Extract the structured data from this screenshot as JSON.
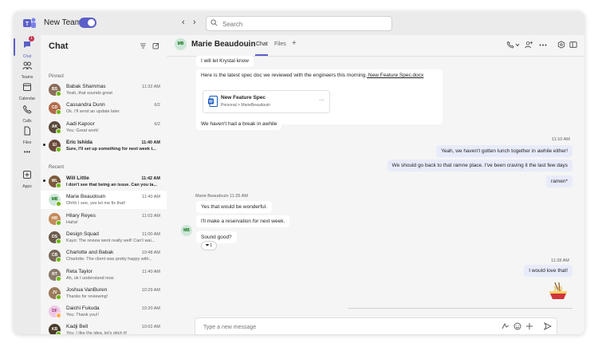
{
  "app": {
    "title": "New Teams",
    "toggle_on": true,
    "back_label": "‹",
    "forward_label": "›",
    "search_placeholder": "Search"
  },
  "rail": {
    "items": [
      {
        "label": "Chat",
        "icon": "chat-icon",
        "badge": "1",
        "active": true
      },
      {
        "label": "Teams",
        "icon": "teams-icon"
      },
      {
        "label": "Calendar",
        "icon": "calendar-icon"
      },
      {
        "label": "Calls",
        "icon": "calls-icon"
      },
      {
        "label": "Files",
        "icon": "files-icon"
      },
      {
        "label": "Apps",
        "icon": "apps-icon"
      }
    ],
    "more_label": "•••"
  },
  "chatlist": {
    "title": "Chat",
    "pinned_label": "Pinned",
    "recent_label": "Recent",
    "pinned": [
      {
        "name": "Babak Shammas",
        "time": "11:32 AM",
        "preview": "Yeah, that sounds great",
        "initials": "BS",
        "color": "#8a6d5a"
      },
      {
        "name": "Cassandra Dunn",
        "time": "6/2",
        "preview": "Ok. I'll send an update later.",
        "initials": "CD",
        "color": "#b36b4a"
      },
      {
        "name": "Aadi Kapoor",
        "time": "6/2",
        "preview": "You: Great work!",
        "initials": "AK",
        "color": "#5a4a3a"
      },
      {
        "name": "Eric Ishida",
        "time": "11:40 AM",
        "preview": "Sure, I'll set up something for next week t...",
        "initials": "EI",
        "color": "#6b4a3a",
        "unread": true
      }
    ],
    "recent": [
      {
        "name": "Will Little",
        "time": "11:42 AM",
        "preview": "I don't see that being an issue. Can you ta...",
        "initials": "WL",
        "color": "#7a5a3a",
        "unread": true
      },
      {
        "name": "Marie Beaudouin",
        "time": "11:40 AM",
        "preview": "Ohhh I see, yes let me fix that!",
        "initials": "MB",
        "color": "#cde6d8",
        "text": "#0e700e",
        "selected": true
      },
      {
        "name": "Hilary Reyes",
        "time": "11:02 AM",
        "preview": "Haha!",
        "initials": "HR",
        "color": "#c48a5a"
      },
      {
        "name": "Design Squad",
        "time": "11:00 AM",
        "preview": "Kayo: The review went really well! Can't wai...",
        "initials": "DS",
        "color": "#6a5a4a"
      },
      {
        "name": "Charlotte and Babak",
        "time": "10:48 AM",
        "preview": "Charlotte: The client was pretty happy with...",
        "initials": "CB",
        "color": "#7a6a5a"
      },
      {
        "name": "Reta Taylor",
        "time": "11:40 AM",
        "preview": "Ah, ok I understand now.",
        "initials": "RT",
        "color": "#8a7a6a"
      },
      {
        "name": "Joshua VanBuren",
        "time": "10:29 AM",
        "preview": "Thanks for reviewing!",
        "initials": "JV",
        "color": "#9a7a5a"
      },
      {
        "name": "Daichi Fukuda",
        "time": "10:20 AM",
        "preview": "You: Thank you!!",
        "initials": "DF",
        "color": "#f0c8e8",
        "text": "#943670",
        "away": true
      },
      {
        "name": "Kadji Bell",
        "time": "10:02 AM",
        "preview": "You: I like the idea, let's pitch it!",
        "initials": "KB",
        "color": "#4a3a2a"
      }
    ]
  },
  "conversation": {
    "name": "Marie Beaudouin",
    "initials": "MB",
    "tabs": [
      "Chat",
      "Files"
    ],
    "add_tab": "+",
    "msgs": {
      "m1": "I will let Krystal know",
      "m2_text": "Here is the latest spec doc we reviewed with the engineers this morning.",
      "m2_link": " New Feature Spec.docx",
      "file_name": "New Feature Spec",
      "file_path": "Personal > MarieBeaudouin",
      "m3": "We haven't had a break in awhile",
      "time1": "11:10 AM",
      "o1": "Yeah, we haven't gotten lunch together in awhile either!",
      "o2": "We should go back to that ramne place. I've been craving it the last few days",
      "o3": "ramen*",
      "sender_stamp": "Marie Beaudouin 11:25 AM",
      "i1": "Yes that would be wonderful.",
      "i2": "I'll make a reservation for next week.",
      "i3": "Sound good?",
      "reaction": "❤ 1",
      "time2": "11:28 AM",
      "o4": "I would love that!"
    },
    "compose_placeholder": "Type a new message"
  }
}
